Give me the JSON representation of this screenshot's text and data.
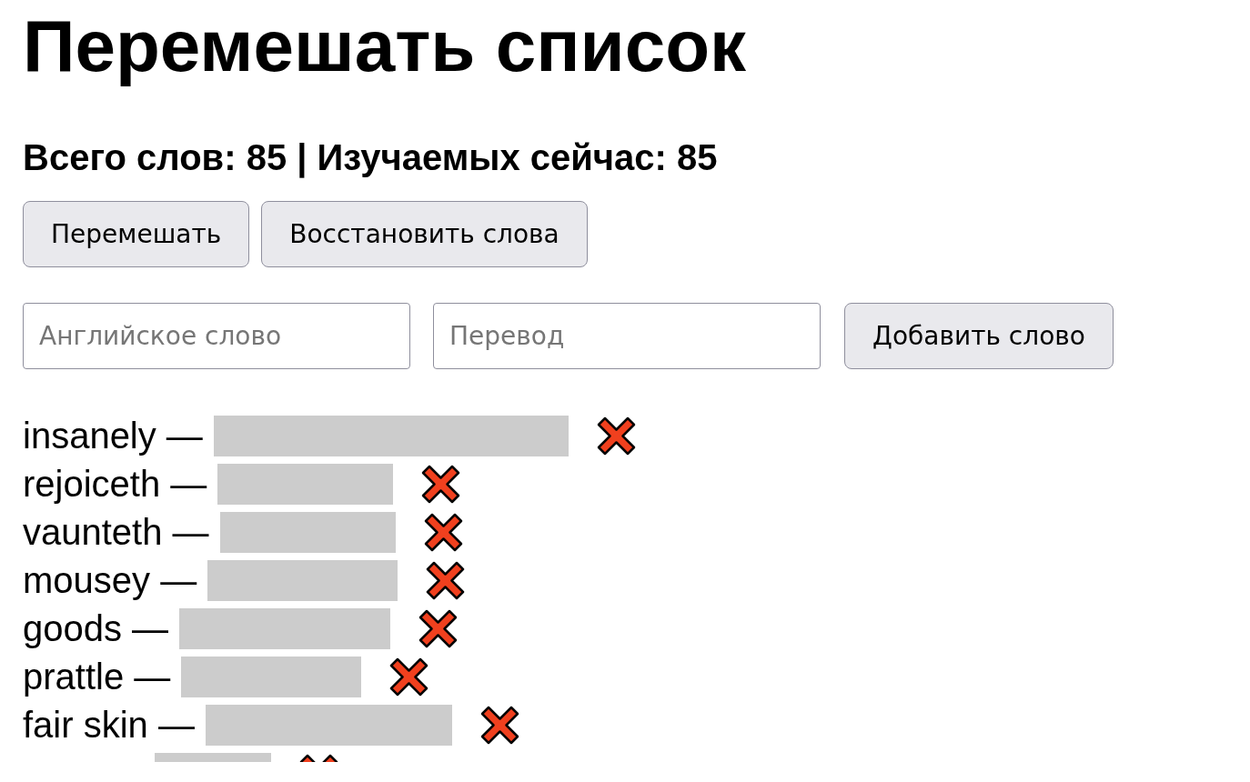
{
  "title": "Перемешать список",
  "summary": "Всего слов: 85 | Изучаемых сейчас: 85",
  "actions": [
    "Перемешать",
    "Восстановить слова"
  ],
  "add_form": {
    "english_placeholder": "Английское слово",
    "translation_placeholder": "Перевод",
    "button": "Добавить слово"
  },
  "words": [
    {
      "label": "insanely —",
      "translation_hidden": true
    },
    {
      "label": "rejoiceth —",
      "translation_hidden": true
    },
    {
      "label": "vaunteth —",
      "translation_hidden": true
    },
    {
      "label": "mousey —",
      "translation_hidden": true
    },
    {
      "label": "goods —",
      "translation_hidden": true
    },
    {
      "label": "prattle —",
      "translation_hidden": true
    },
    {
      "label": "fair skin —",
      "translation_hidden": true
    },
    {
      "translation_hidden": true
    }
  ]
}
